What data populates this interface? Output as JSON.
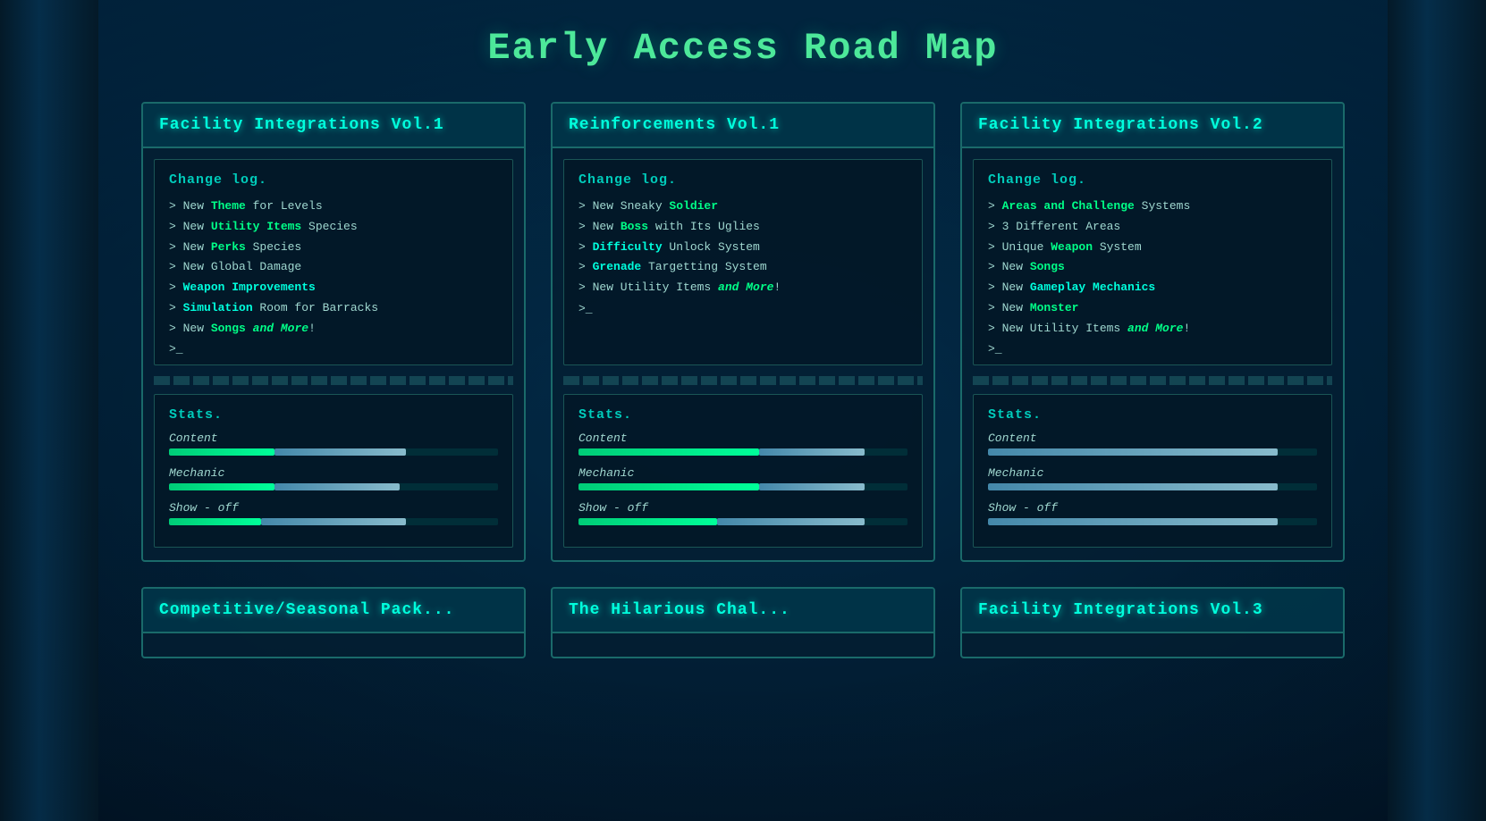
{
  "page": {
    "title": "Early Access Road Map"
  },
  "cards": [
    {
      "id": "facility-vol1",
      "title": "Facility Integrations Vol.1",
      "changelog_label": "Change log.",
      "items": [
        {
          "prefix": "> New ",
          "parts": [
            {
              "text": "Theme",
              "style": "highlight-green"
            },
            {
              "text": " for Levels",
              "style": "plain"
            }
          ]
        },
        {
          "prefix": "> New ",
          "parts": [
            {
              "text": "Utility Items",
              "style": "highlight-green"
            },
            {
              "text": " Species",
              "style": "plain"
            }
          ]
        },
        {
          "prefix": "> New ",
          "parts": [
            {
              "text": "Perks",
              "style": "highlight-green"
            },
            {
              "text": " Species",
              "style": "plain"
            }
          ]
        },
        {
          "prefix": "> New ",
          "parts": [
            {
              "text": "Global Damage",
              "style": "plain"
            }
          ]
        },
        {
          "prefix": "> ",
          "parts": [
            {
              "text": "Weapon Improvements",
              "style": "highlight-cyan"
            }
          ]
        },
        {
          "prefix": "> ",
          "parts": [
            {
              "text": "Simulation",
              "style": "highlight-cyan"
            },
            {
              "text": " Room for Barracks",
              "style": "plain"
            }
          ]
        },
        {
          "prefix": "> New ",
          "parts": [
            {
              "text": "Songs",
              "style": "highlight-green"
            },
            {
              "text": " ",
              "style": "plain"
            },
            {
              "text": "and More",
              "style": "highlight-italic"
            },
            {
              "text": "!",
              "style": "plain"
            }
          ]
        }
      ],
      "stats_label": "Stats.",
      "stats": [
        {
          "label": "Content",
          "fill_green": 32,
          "fill_gray": 40
        },
        {
          "label": "Mechanic",
          "fill_green": 32,
          "fill_gray": 38
        },
        {
          "label": "Show - off",
          "fill_green": 28,
          "fill_gray": 44
        }
      ]
    },
    {
      "id": "reinforcements-vol1",
      "title": "Reinforcements Vol.1",
      "changelog_label": "Change log.",
      "items": [
        {
          "prefix": "> New Sneaky ",
          "parts": [
            {
              "text": "Soldier",
              "style": "highlight-green"
            }
          ]
        },
        {
          "prefix": "> New ",
          "parts": [
            {
              "text": "Boss",
              "style": "highlight-green"
            },
            {
              "text": " with Its Uglies",
              "style": "plain"
            }
          ]
        },
        {
          "prefix": "> ",
          "parts": [
            {
              "text": "Difficulty",
              "style": "highlight-cyan"
            },
            {
              "text": " Unlock System",
              "style": "plain"
            }
          ]
        },
        {
          "prefix": "> ",
          "parts": [
            {
              "text": "Grenade",
              "style": "highlight-cyan"
            },
            {
              "text": " Targetting System",
              "style": "plain"
            }
          ]
        },
        {
          "prefix": "> New Utility Items ",
          "parts": [
            {
              "text": "and More",
              "style": "highlight-italic"
            },
            {
              "text": "!",
              "style": "plain"
            }
          ]
        }
      ],
      "stats_label": "Stats.",
      "stats": [
        {
          "label": "Content",
          "fill_green": 55,
          "fill_gray": 32
        },
        {
          "label": "Mechanic",
          "fill_green": 55,
          "fill_gray": 32
        },
        {
          "label": "Show - off",
          "fill_green": 42,
          "fill_gray": 45
        }
      ]
    },
    {
      "id": "facility-vol2",
      "title": "Facility Integrations Vol.2",
      "changelog_label": "Change log.",
      "items": [
        {
          "prefix": "> ",
          "parts": [
            {
              "text": "Areas and Challenge",
              "style": "highlight-green"
            },
            {
              "text": " Systems",
              "style": "plain"
            }
          ]
        },
        {
          "prefix": "> ",
          "parts": [
            {
              "text": "3 Different Areas",
              "style": "plain"
            }
          ]
        },
        {
          "prefix": "> Unique ",
          "parts": [
            {
              "text": "Weapon",
              "style": "highlight-green"
            },
            {
              "text": " System",
              "style": "plain"
            }
          ]
        },
        {
          "prefix": "> New ",
          "parts": [
            {
              "text": "Songs",
              "style": "highlight-green"
            }
          ]
        },
        {
          "prefix": "> New ",
          "parts": [
            {
              "text": "Gameplay Mechanics",
              "style": "highlight-cyan"
            }
          ]
        },
        {
          "prefix": "> New ",
          "parts": [
            {
              "text": "Monster",
              "style": "highlight-green"
            }
          ]
        },
        {
          "prefix": "> New Utility Items ",
          "parts": [
            {
              "text": "and More",
              "style": "highlight-italic"
            },
            {
              "text": "!",
              "style": "plain"
            }
          ]
        }
      ],
      "stats_label": "Stats.",
      "stats": [
        {
          "label": "Content",
          "fill_green": 0,
          "fill_gray": 88
        },
        {
          "label": "Mechanic",
          "fill_green": 0,
          "fill_gray": 88
        },
        {
          "label": "Show - off",
          "fill_green": 0,
          "fill_gray": 88
        }
      ]
    }
  ],
  "bottom_cards": [
    {
      "title": "Competitive/Seasonal Pack..."
    },
    {
      "title": "The Hilarious Chal..."
    },
    {
      "title": "Facility Integrations Vol.3"
    }
  ]
}
